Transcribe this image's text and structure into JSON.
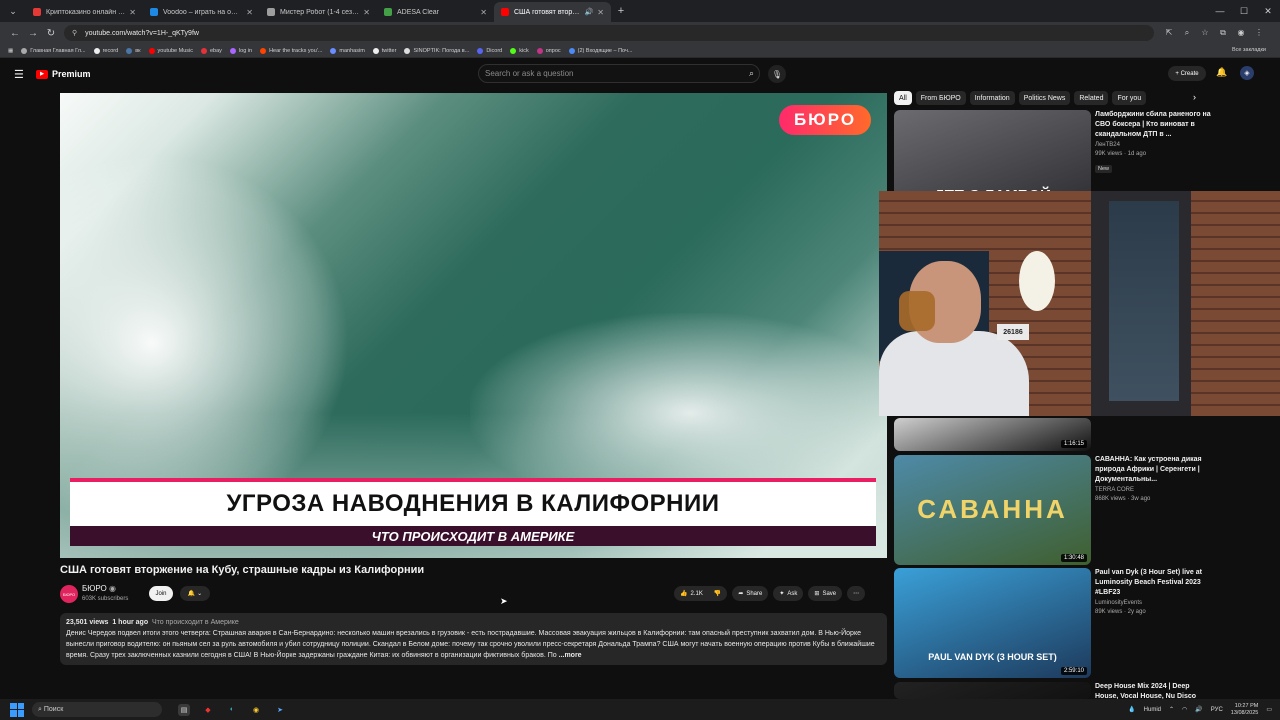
{
  "browser": {
    "tabs": [
      {
        "title": "Криптоказино онлайн VAVAD...",
        "active": false,
        "color": "#e53935"
      },
      {
        "title": "Voodoo – играть на официальн...",
        "active": false,
        "color": "#1e88e5"
      },
      {
        "title": "Мистер Робот (1-4 сезон) см...",
        "active": false,
        "color": "#9e9e9e"
      },
      {
        "title": "ADESA Clear",
        "active": false,
        "color": "#43a047"
      },
      {
        "title": "США готовят вторжение н...",
        "active": true,
        "color": "#ff0000"
      }
    ],
    "url": "youtube.com/watch?v=1H-_qKTy9fw",
    "bookmarks": [
      "Главная Главная Гл...",
      "record",
      "вк",
      "youtube Music",
      "ebay",
      "log in",
      "Hear the tracks you'...",
      "manhasim",
      "twitter",
      "SINOPTIK: Погода в...",
      "Dicord",
      "kick",
      "опрос",
      "(2) Входящие – Поч..."
    ],
    "bookmarks_all": "Все закладки"
  },
  "youtube": {
    "logo": "Premium",
    "search_placeholder": "Search or ask a question",
    "create_label": "Create"
  },
  "video": {
    "brand": "БЮРО",
    "lower_third_title": "УГРОЗА НАВОДНЕНИЯ В КАЛИФОРНИИ",
    "lower_third_subtitle": "ЧТО ПРОИСХОДИТ В АМЕРИКЕ",
    "title": "США готовят вторжение на Кубу, страшные кадры из Калифорнии",
    "channel": "БЮРО",
    "subscribers": "603K subscribers",
    "join": "Join",
    "likes": "2.1K",
    "share": "Share",
    "ask": "Ask",
    "save": "Save",
    "views": "23,501 views",
    "age": "1 hour ago",
    "hashtag": "Что происходит в Америке",
    "description": "Денис Чередов подвел итоги этого четверга: Страшная авария в Сан-Бернардино: несколько машин врезались в грузовик - есть пострадавшие. Массовая эвакуация жильцов в Калифорнии: там опасный преступник захватил дом. В Нью-Йорке вынесли приговор водителю: он пьяным сел за руль автомобиля и убил сотрудницу полиции. Скандал в Белом доме: почему так срочно уволили пресс-секретаря Дональда Трампа? США могут начать военную операцию против Кубы в ближайшие время. Сразу трех заключенных казнили сегодня в США! В Нью-Йорке задержаны граждане Китая: их обвиняют в организации фиктивных браков. По",
    "more": "...more"
  },
  "chips": [
    "All",
    "From БЮРО",
    "Information",
    "Politics News",
    "Related",
    "For you"
  ],
  "recommendations": [
    {
      "title": "Ламборджини сбила раненого на СВО боксера | Кто виноват в скандальном ДТП в ...",
      "channel": "ЛенТВ24",
      "meta": "99K views · 1d ago",
      "badge": "New",
      "duration": "",
      "overlay": "ДТП С ЛАМБОЙ",
      "colors": [
        "#6b6b70",
        "#2a2a2e"
      ]
    },
    {
      "title": "",
      "channel": "",
      "meta": "",
      "badge": "",
      "duration": "1:16:15",
      "overlay": "",
      "colors": [
        "#cfcfcf",
        "#111"
      ]
    },
    {
      "title": "САВАННА: Как устроена дикая природа Африки | Серенгети | Документальны...",
      "channel": "TERRA CORE",
      "meta": "868K views · 3w ago",
      "badge": "",
      "duration": "1:30:48",
      "overlay": "САВАННА",
      "colors": [
        "#4e8aa8",
        "#3f5f2e"
      ]
    },
    {
      "title": "Paul van Dyk (3 Hour Set) live at Luminosity Beach Festival 2023 #LBF23",
      "channel": "LuminosityEvents",
      "meta": "89K views · 2y ago",
      "badge": "",
      "duration": "2:59:10",
      "overlay": "PAUL VAN DYK (3 HOUR SET)",
      "colors": [
        "#3aa0d8",
        "#1d3a5c"
      ]
    },
    {
      "title": "Deep House Mix 2024 | Deep House, Vocal House, Nu Disco",
      "channel": "",
      "meta": "",
      "badge": "",
      "duration": "",
      "overlay": "",
      "colors": [
        "#222",
        "#111"
      ]
    }
  ],
  "webcam": {
    "plate": "26186"
  },
  "taskbar": {
    "search": "Поиск",
    "weather": "Humid",
    "lang": "РУС",
    "time": "10:27 PM",
    "date": "13/08/2025"
  }
}
